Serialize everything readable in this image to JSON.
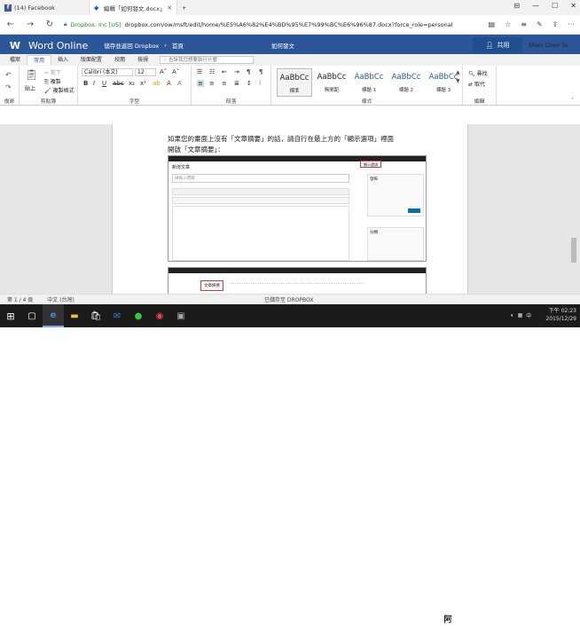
{
  "browser": {
    "tabs": [
      {
        "title": "(14) Facebook",
        "icon": "facebook-icon"
      },
      {
        "title": "編輯「如何發文.docx」",
        "icon": "dropbox-icon"
      }
    ],
    "address": {
      "org": "Dropbox, Inc [US]",
      "url": "dropbox.com/ow/msft/edit/home/%E5%A6%82%E4%BD%95%E7%99%BC%E6%96%87.docx?force_role=personal"
    }
  },
  "word": {
    "app_name": "Word Online",
    "breadcrumb_back": "儲存並返回 Dropbox",
    "breadcrumb_home": "首頁",
    "doc_title": "如何發文",
    "share_label": "共用",
    "user_name": "Shen Chen Ta"
  },
  "ribbon": {
    "tabs": [
      "檔案",
      "常用",
      "插入",
      "版面配置",
      "校閱",
      "檢視"
    ],
    "selected_tab": "常用",
    "tell_me_placeholder": "告訴我您想要執行什麼",
    "clipboard": {
      "paste": "貼上",
      "cut": "剪下",
      "copy": "複製",
      "format_painter": "複製格式",
      "group": "剪貼簿"
    },
    "undo_group": "復原",
    "font": {
      "name": "Calibri (本文)",
      "size": "12",
      "group": "字型"
    },
    "paragraph_group": "段落",
    "styles": [
      {
        "preview": "AaBbCc",
        "name": "標準"
      },
      {
        "preview": "AaBbCc",
        "name": "無間距"
      },
      {
        "preview": "AaBbCc",
        "name": "標題 1"
      },
      {
        "preview": "AaBbCc",
        "name": "標題 2"
      },
      {
        "preview": "AaBbCc",
        "name": "標題 3"
      }
    ],
    "styles_group": "樣式",
    "editing": {
      "find": "尋找",
      "replace": "取代",
      "group": "編輯"
    }
  },
  "document": {
    "paragraph_line1": "如果您的畫面上沒有「文章摘要」的話，請自行在最上方的「顯示選項」裡面",
    "paragraph_line2": "開啟「文章摘要」：",
    "embedded": {
      "header": "新增文章",
      "title_placeholder": "請輸入標題",
      "display_options": "顯示選項",
      "publish": "發佈",
      "category": "分類",
      "excerpt": "文章摘要"
    }
  },
  "status": {
    "page": "第 1 / 4 頁",
    "language": "中文 (台灣)",
    "saved": "已儲存至 DROPBOX"
  },
  "taskbar": {
    "time": "下午 02:23",
    "date": "2015/12/29",
    "ime": "中",
    "watermark": "電腦王阿達"
  }
}
